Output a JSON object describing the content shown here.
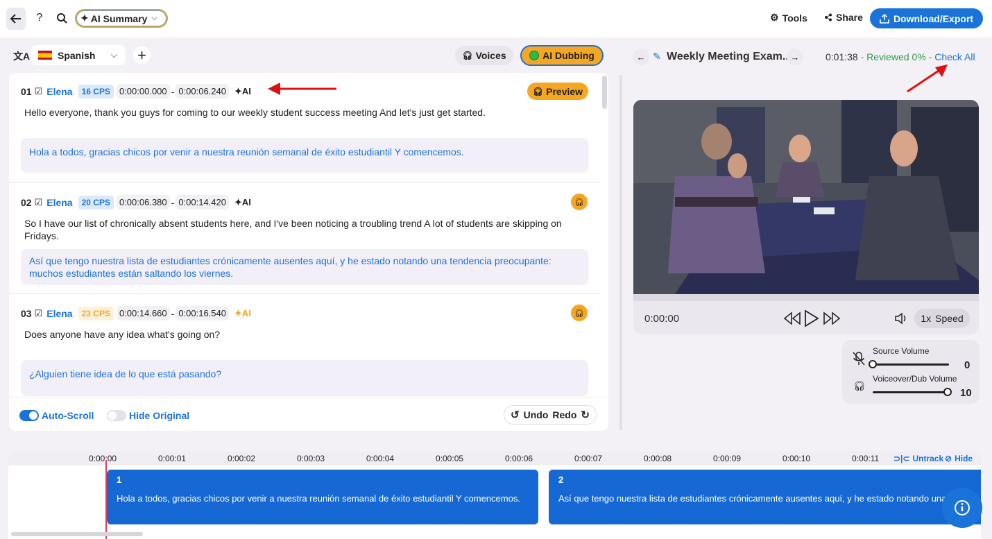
{
  "toolbar": {
    "ai_summary_label": "AI Summary",
    "tools_label": "Tools",
    "share_label": "Share",
    "download_label": "Download/Export"
  },
  "language": {
    "selected": "Spanish"
  },
  "dubbing": {
    "voices_label": "Voices",
    "ai_dubbing_label": "AI Dubbing"
  },
  "segments": [
    {
      "num": "01",
      "speaker": "Elena",
      "cps": "16 CPS",
      "start": "0:00:00.000",
      "end": "0:00:06.240",
      "ai_tag": "AI",
      "preview_label": "Preview",
      "original": "Hello everyone, thank you guys for coming to our weekly student success meeting And let's just get started.",
      "translation": "Hola a todos, gracias chicos por venir a nuestra reunión semanal de éxito estudiantil Y comencemos."
    },
    {
      "num": "02",
      "speaker": "Elena",
      "cps": "20 CPS",
      "start": "0:00:06.380",
      "end": "0:00:14.420",
      "ai_tag": "AI",
      "original": "So I have our list of chronically absent students here, and I've been noticing a troubling trend A lot of students are skipping on Fridays.",
      "translation": "Así que tengo nuestra lista de estudiantes crónicamente ausentes aquí, y he estado notando una tendencia preocupante: muchos estudiantes están saltando los viernes."
    },
    {
      "num": "03",
      "speaker": "Elena",
      "cps": "23 CPS",
      "start": "0:00:14.660",
      "end": "0:00:16.540",
      "ai_tag": "AI",
      "original": "Does anyone have any idea what's going on?",
      "translation": "¿Alguien tiene idea de lo que está pasando?"
    }
  ],
  "bottom_controls": {
    "auto_scroll_label": "Auto-Scroll",
    "hide_original_label": "Hide Original",
    "undo_label": "Undo",
    "redo_label": "Redo"
  },
  "right_panel": {
    "title": "Weekly Meeting Exam...",
    "duration": "0:01:38",
    "separator1": " - ",
    "reviewed": "Reviewed 0%",
    "separator2": " - ",
    "check_all": "Check All"
  },
  "player": {
    "current_time": "0:00:00",
    "speed_value": "1x",
    "speed_label": "Speed"
  },
  "volume": {
    "source_label": "Source Volume",
    "source_value": "0",
    "source_level": 0,
    "dub_label": "Voiceover/Dub Volume",
    "dub_value": "10",
    "dub_level": 1
  },
  "timeline": {
    "ticks": [
      "0:00:00",
      "0:00:01",
      "0:00:02",
      "0:00:03",
      "0:00:04",
      "0:00:05",
      "0:00:06",
      "0:00:07",
      "0:00:08",
      "0:00:09",
      "0:00:10",
      "0:00:11"
    ],
    "untrack_label": "Untrack",
    "hide_label": "Hide",
    "clips": [
      {
        "num": "1",
        "text": "Hola a todos, gracias chicos por venir a nuestra reunión semanal de éxito estudiantil Y comencemos."
      },
      {
        "num": "2",
        "text": "Así que tengo nuestra lista de estudiantes crónicamente ausentes aquí, y he estado notando una tendencia preocupante: muchos estudiantes están saltando los viernes."
      }
    ]
  },
  "colors": {
    "accent": "#1a73d8",
    "orange": "#f5a623",
    "reviewed": "#2e9c48"
  }
}
